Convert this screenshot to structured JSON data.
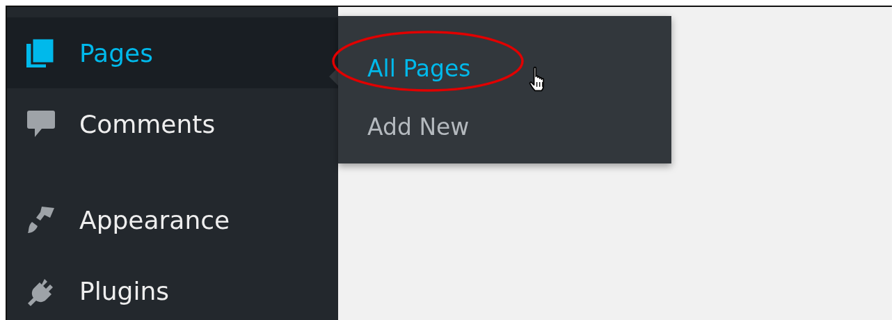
{
  "menu": [
    {
      "label": "Pages",
      "selected": true
    },
    {
      "label": "Comments",
      "selected": false
    },
    {
      "label": "Appearance",
      "selected": false,
      "separator_before": true
    },
    {
      "label": "Plugins",
      "selected": false
    }
  ],
  "submenu": [
    {
      "label": "All Pages",
      "selected": true
    },
    {
      "label": "Add New",
      "selected": false
    }
  ]
}
